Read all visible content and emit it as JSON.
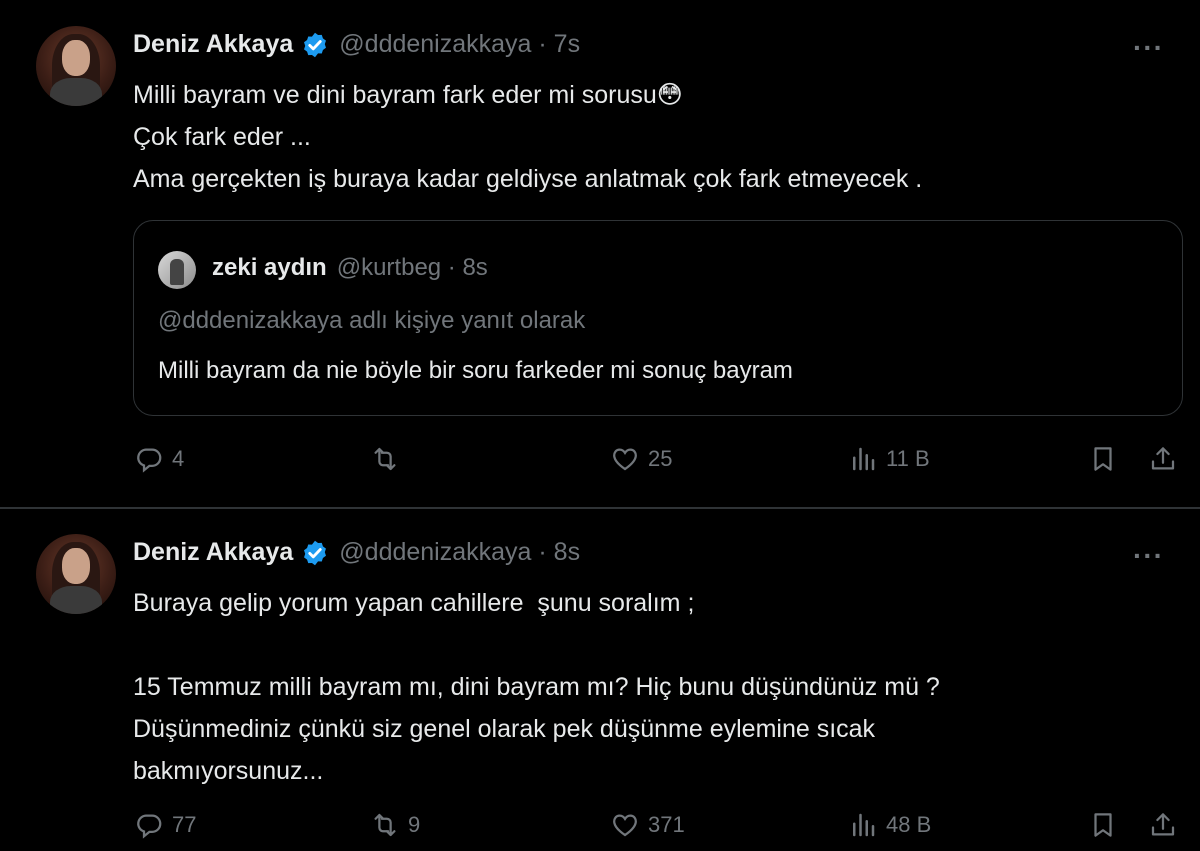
{
  "tweets": [
    {
      "author": {
        "name": "Deniz Akkaya",
        "handle_time": "@dddenizakkaya · 7s"
      },
      "text": "Milli bayram ve dini bayram fark eder mi sorusu😳\nÇok fark eder ...\nAma gerçekten iş buraya kadar geldiyse anlatmak çok fark etmeyecek .",
      "quote": {
        "name": "zeki aydın",
        "handle_time": "@kurtbeg · 8s",
        "reply_to": "@dddenizakkaya adlı kişiye yanıt olarak",
        "text": "Milli bayram da nie böyle bir soru farkeder mi sonuç bayram"
      },
      "actions": {
        "replies": "4",
        "reposts": "",
        "likes": "25",
        "views": "11 B"
      }
    },
    {
      "author": {
        "name": "Deniz Akkaya",
        "handle_time": "@dddenizakkaya · 8s"
      },
      "text": "Buraya gelip yorum yapan cahillere  şunu soralım ;\n\n15 Temmuz milli bayram mı, dini bayram mı? Hiç bunu düşündünüz mü ?\nDüşünmediniz çünkü siz genel olarak pek düşünme eylemine sıcak\nbakmıyorsunuz...",
      "actions": {
        "replies": "77",
        "reposts": "9",
        "likes": "371",
        "views": "48 B"
      }
    }
  ],
  "more_label": "···",
  "colors": {
    "background": "#000000",
    "text": "#e7e9ea",
    "muted": "#71767b",
    "verified": "#1d9bf0",
    "border": "#2f3336"
  },
  "icons": [
    "verified-badge-icon",
    "more-icon",
    "reply-icon",
    "repost-icon",
    "like-icon",
    "views-icon",
    "bookmark-icon",
    "share-icon"
  ]
}
